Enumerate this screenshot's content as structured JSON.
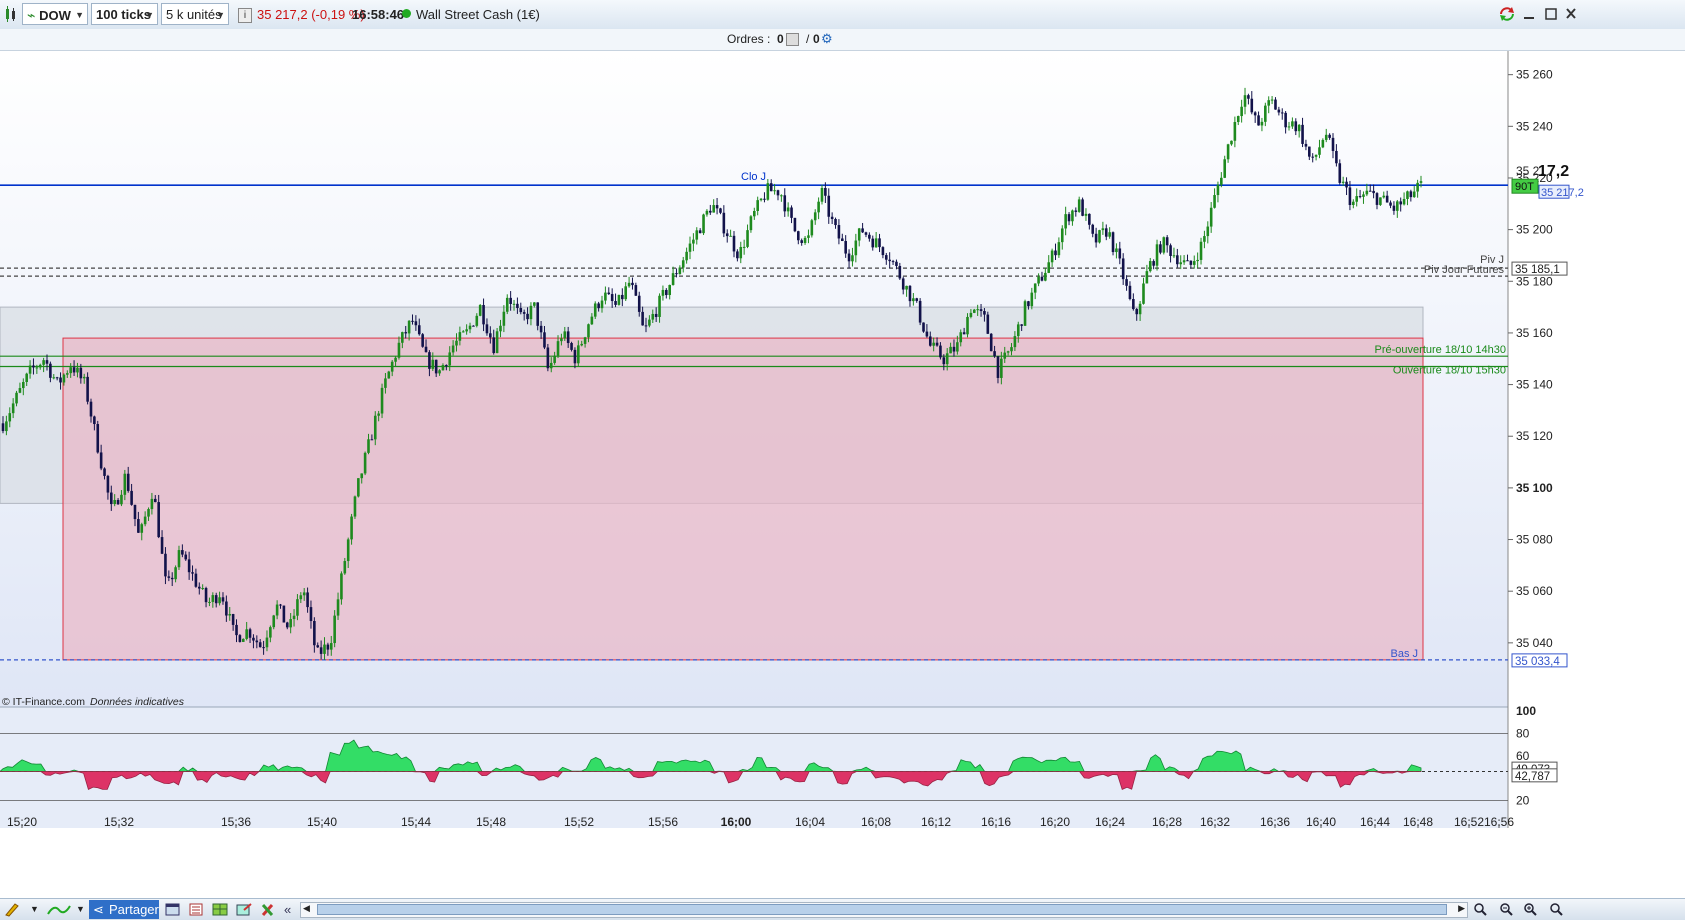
{
  "toolbar": {
    "instrument": "DOW",
    "ticks": "100 ticks",
    "units": "5 k unités",
    "price_change": "35 217,2 (-0,19 %)",
    "time": "16:58:46",
    "market_name": "Wall Street Cash (1€)"
  },
  "orders": {
    "label": "Ordres :",
    "count1": "0",
    "sep": "/",
    "count2": "0"
  },
  "chart_data": {
    "type": "candlestick",
    "y_axis_labels": [
      "35 260",
      "35 240",
      "35 220",
      "35 200",
      "35 180",
      "35 160",
      "35 140",
      "35 120",
      "35 100",
      "35 080",
      "35 060",
      "35 040"
    ],
    "y_axis_values": [
      35260,
      35240,
      35220,
      35200,
      35180,
      35160,
      35140,
      35120,
      35100,
      35080,
      35060,
      35040
    ],
    "x_axis_labels": [
      "15:20",
      "15:32",
      "15:36",
      "15:40",
      "15:44",
      "15:48",
      "15:52",
      "15:56",
      "16:00",
      "16:04",
      "16:08",
      "16:12",
      "16:16",
      "16:20",
      "16:24",
      "16:28",
      "16:32",
      "16:36",
      "16:40",
      "16:44",
      "16:48",
      "16:52",
      "16:56"
    ],
    "ylim": [
      35026,
      35268
    ],
    "price_path": [
      35125,
      35135,
      35145,
      35150,
      35140,
      35148,
      35140,
      35115,
      35090,
      35105,
      35080,
      35100,
      35060,
      35075,
      35065,
      35055,
      35060,
      35042,
      35045,
      35038,
      35055,
      35045,
      35062,
      35035,
      35040,
      35070,
      35100,
      35120,
      35140,
      35155,
      35165,
      35150,
      35145,
      35155,
      35160,
      35170,
      35155,
      35175,
      35165,
      35170,
      35145,
      35160,
      35150,
      35165,
      35175,
      35170,
      35180,
      35160,
      35170,
      35180,
      35190,
      35200,
      35210,
      35200,
      35190,
      35205,
      35215,
      35215,
      35200,
      35195,
      35215,
      35200,
      35190,
      35200,
      35195,
      35190,
      35180,
      35170,
      35155,
      35150,
      35155,
      35170,
      35165,
      35145,
      35155,
      35170,
      35180,
      35190,
      35205,
      35210,
      35195,
      35200,
      35185,
      35165,
      35185,
      35195,
      35190,
      35185,
      35195,
      35215,
      35235,
      35253,
      35240,
      35250,
      35242,
      35240,
      35225,
      35238,
      35220,
      35210,
      35214,
      35212,
      35208,
      35212,
      35217
    ],
    "lines": [
      {
        "label": "Clo J",
        "value": 35217.2,
        "color": "#0033cc"
      },
      {
        "label": "Piv J",
        "value": 35185.1,
        "color": "#444"
      },
      {
        "label": "Piv Jour Futures",
        "value": 35182,
        "color": "#444"
      },
      {
        "label": "Pré-ouverture 18/10 14h30",
        "value": 35151,
        "color": "#1a8a1a"
      },
      {
        "label": "Ouverture 18/10 15h30",
        "value": 35147,
        "color": "#1a8a1a"
      },
      {
        "label": "Bas J",
        "value": 35033.4,
        "color": "#3355cc"
      }
    ],
    "price_tags": [
      {
        "text": "17,2",
        "prefix": "35 2",
        "value": 35217.2
      },
      {
        "text": "90T",
        "value": 35217.2
      },
      {
        "text": "35 217,2",
        "value": 35217.2
      },
      {
        "text": "35 185,1",
        "value": 35185.1
      },
      {
        "text": "35 033,4",
        "value": 35033.4
      }
    ],
    "zones": [
      {
        "from": 35094,
        "to": 35170,
        "color": "#d8dde4"
      },
      {
        "from": 35033.4,
        "to": 35158,
        "color": "#e9b7c6"
      }
    ],
    "copyright": "© IT-Finance.com",
    "copyright_note": "Données indicatives"
  },
  "indicator": {
    "y_axis_labels": [
      "100",
      "80",
      "60",
      "20"
    ],
    "values_shown": [
      "49,073",
      "42,787"
    ]
  },
  "bottombar": {
    "share_label": "Partager"
  },
  "colors": {
    "bull": "#1e8a1e",
    "bear": "#12124a",
    "oscillator_up": "#33dd66",
    "oscillator_down": "#dd3366"
  }
}
